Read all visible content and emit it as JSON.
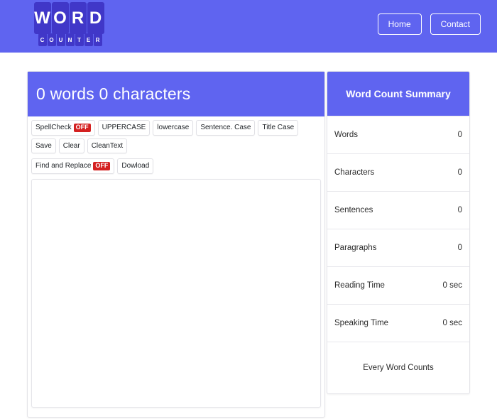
{
  "navbar": {
    "logo": {
      "primary": "WORD",
      "secondary": "COUNTER",
      "tile_color": "#4037c8",
      "bar_color": "#5f64f0"
    },
    "links": [
      {
        "label": "Home",
        "name": "nav-link-home"
      },
      {
        "label": "Contact",
        "name": "nav-link-contact"
      }
    ]
  },
  "editor": {
    "header_title": "0 words 0 characters",
    "word_count": 0,
    "char_count": 0,
    "toolbar_row1": [
      {
        "label": "SpellCheck",
        "badge": "OFF",
        "name": "spellcheck-button"
      },
      {
        "label": "UPPERCASE",
        "badge": "",
        "name": "uppercase-button"
      },
      {
        "label": "lowercase",
        "badge": "",
        "name": "lowercase-button"
      },
      {
        "label": "Sentence. Case",
        "badge": "",
        "name": "sentence-case-button"
      },
      {
        "label": "Title Case",
        "badge": "",
        "name": "title-case-button"
      },
      {
        "label": "Save",
        "badge": "",
        "name": "save-button"
      },
      {
        "label": "Clear",
        "badge": "",
        "name": "clear-button"
      },
      {
        "label": "CleanText",
        "badge": "",
        "name": "cleantext-button"
      }
    ],
    "toolbar_row2": [
      {
        "label": "Find and Replace",
        "badge": "OFF",
        "name": "find-and-replace-button"
      },
      {
        "label": "Dowload",
        "badge": "",
        "name": "download-button"
      }
    ],
    "textarea": {
      "value": "",
      "placeholder": ""
    }
  },
  "summary": {
    "title": "Word Count Summary",
    "rows": [
      {
        "label": "Words",
        "value": "0"
      },
      {
        "label": "Characters",
        "value": "0"
      },
      {
        "label": "Sentences",
        "value": "0"
      },
      {
        "label": "Paragraphs",
        "value": "0"
      },
      {
        "label": "Reading Time",
        "value": "0 sec"
      },
      {
        "label": "Speaking Time",
        "value": "0 sec"
      }
    ],
    "footer": "Every Word Counts"
  }
}
